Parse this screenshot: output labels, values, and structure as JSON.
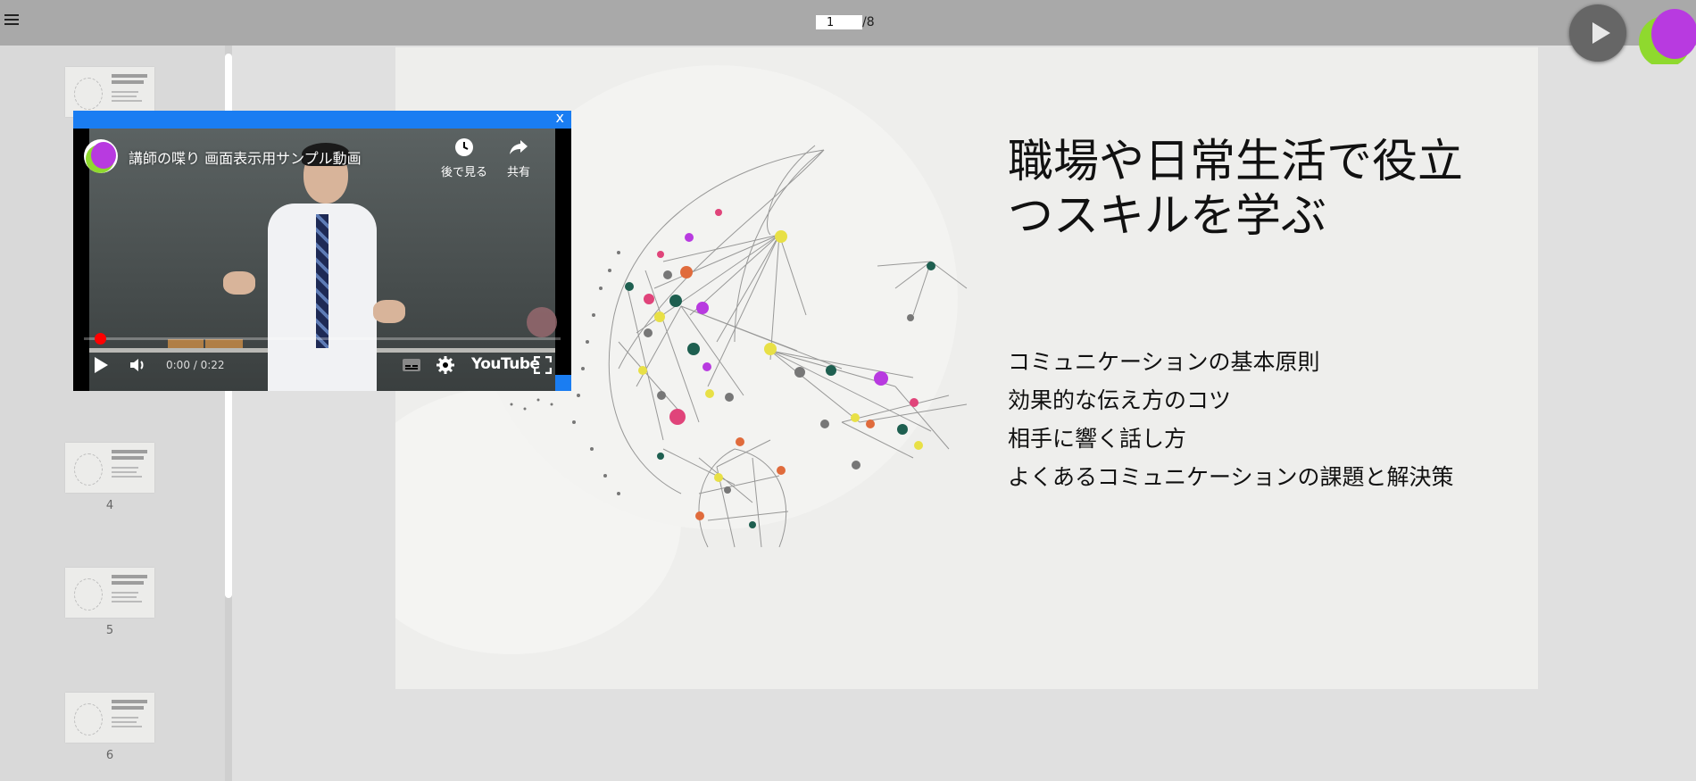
{
  "toolbar": {
    "menu_icon": "hamburger-icon",
    "page_current": "1",
    "page_total": "/8",
    "play_icon": "play-icon"
  },
  "sidebar": {
    "thumbnails": [
      {
        "number": ""
      },
      {
        "number": "4"
      },
      {
        "number": "5"
      },
      {
        "number": "6"
      }
    ]
  },
  "slide": {
    "title": "職場や日常生活で役立つスキルを学ぶ",
    "bullets": [
      "コミュニケーションの基本原則",
      "効果的な伝え方のコツ",
      "相手に響く話し方",
      "よくあるコミュニケーションの課題と解決策"
    ]
  },
  "video": {
    "close_label": "x",
    "title": "講師の喋り 画面表示用サンプル動画",
    "watch_later_label": "後で見る",
    "share_label": "共有",
    "time": "0:00 / 0:22",
    "brand": "YouTube",
    "progress": 0,
    "accent_color": "#1a7df2"
  }
}
